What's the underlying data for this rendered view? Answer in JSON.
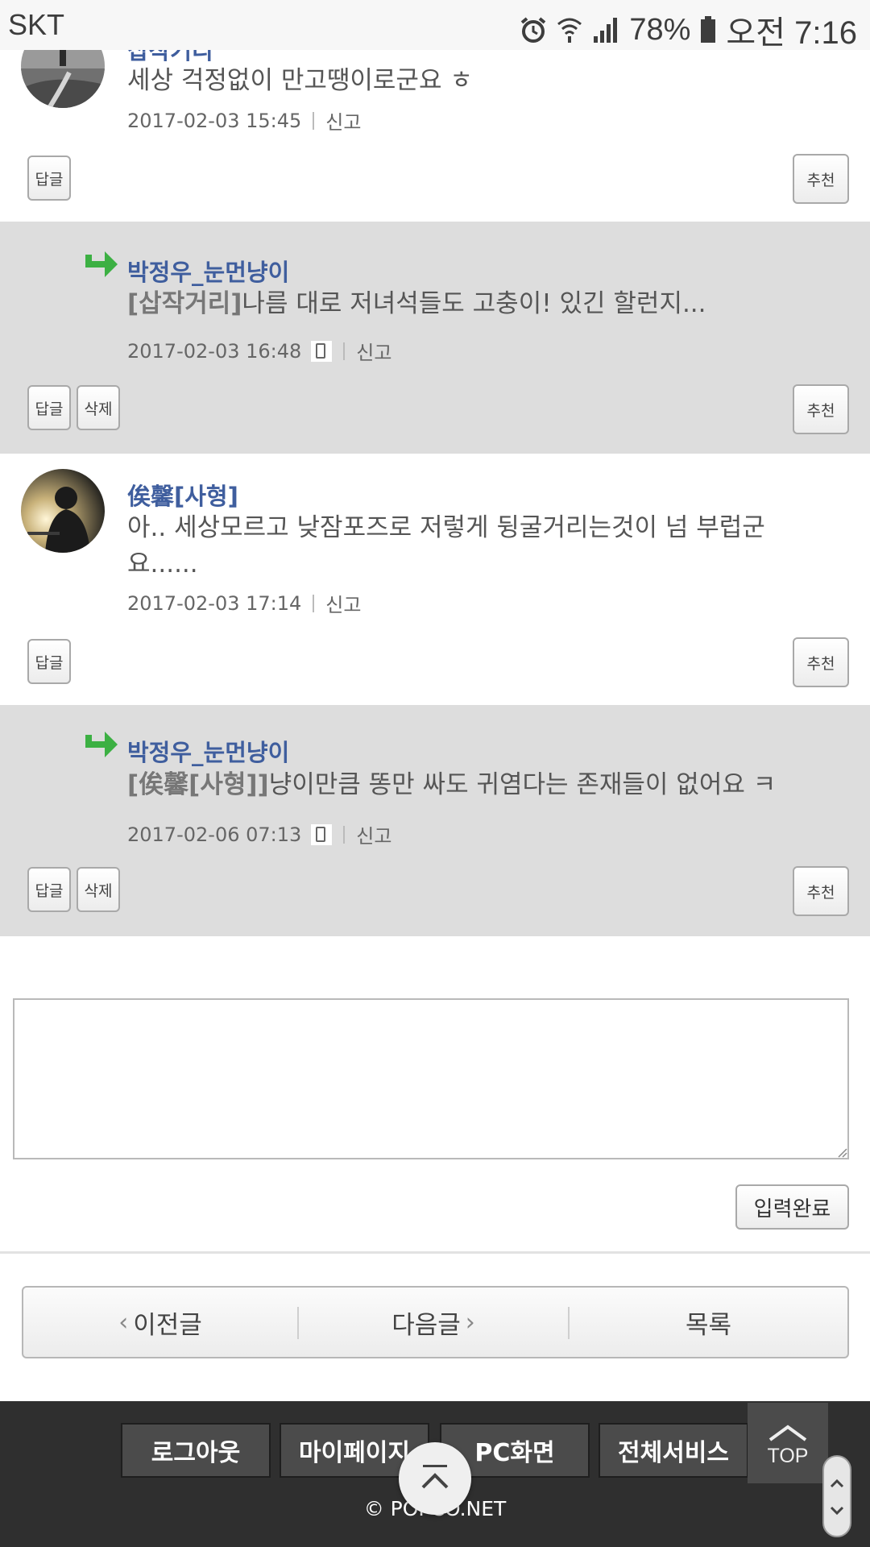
{
  "status_bar": {
    "carrier": "SKT",
    "battery_percent": "78%",
    "time": "오전 7:16"
  },
  "comments": [
    {
      "author": "삽작거리",
      "text": "세상 걱정없이 만고땡이로군요 ㅎ",
      "date": "2017-02-03 15:45",
      "report": "신고",
      "reply_btn": "답글",
      "recommend_btn": "추천"
    },
    {
      "author": "박정우_눈먼냥이",
      "quote": "[삽작거리]",
      "text": "나름 대로 저녀석들도 고충이! 있긴 할런지...",
      "date": "2017-02-03 16:48",
      "report": "신고",
      "reply_btn": "답글",
      "delete_btn": "삭제",
      "recommend_btn": "추천"
    },
    {
      "author": "俟馨[사형]",
      "text": "아.. 세상모르고 낮잠포즈로 저렇게 뒹굴거리는것이 넘 부럽군요......",
      "date": "2017-02-03 17:14",
      "report": "신고",
      "reply_btn": "답글",
      "recommend_btn": "추천"
    },
    {
      "author": "박정우_눈먼냥이",
      "quote": "[俟馨[사형]]",
      "text": "냥이만큼 똥만 싸도 귀염다는 존재들이 없어요 ㅋ",
      "date": "2017-02-06 07:13",
      "report": "신고",
      "reply_btn": "답글",
      "delete_btn": "삭제",
      "recommend_btn": "추천"
    }
  ],
  "comment_form": {
    "textarea_value": "",
    "submit_label": "입력완료"
  },
  "pager": {
    "prev": "이전글",
    "next": "다음글",
    "list": "목록"
  },
  "footer": {
    "logout": "로그아웃",
    "mypage": "마이페이지",
    "pc_view": "PC화면",
    "all_services": "전체서비스",
    "top": "TOP",
    "copyright": "© POPCO.NET"
  },
  "colors": {
    "author_link": "#3f5e9e",
    "reply_bg": "#dddddd",
    "footer_bg": "#2f2f2f",
    "reply_arrow": "#3cb043"
  }
}
